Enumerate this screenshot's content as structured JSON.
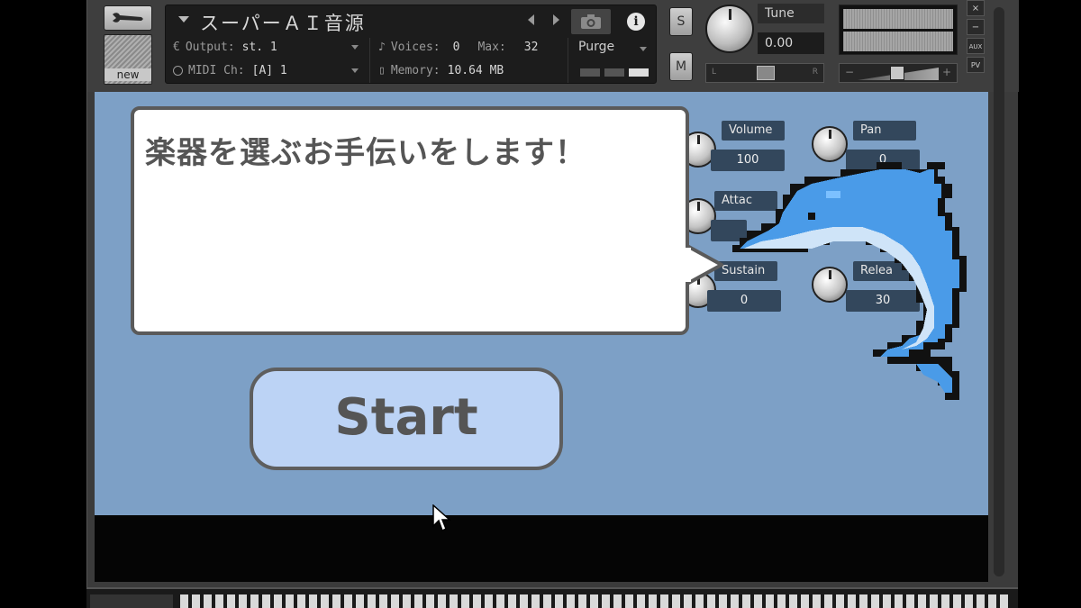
{
  "header": {
    "instrument_name": "スーパーＡＩ音源",
    "output_label": "Output:",
    "output_value": "st. 1",
    "midi_label": "MIDI Ch:",
    "midi_value": "[A]  1",
    "voices_label": "Voices:",
    "voices_value": "0",
    "max_label": "Max:",
    "max_value": "32",
    "memory_label": "Memory:",
    "memory_value": "10.64 MB",
    "purge_label": "Purge",
    "new_label": "new",
    "solo_label": "S",
    "mute_label": "M",
    "tune_label": "Tune",
    "tune_value": "0.00",
    "pan_left": "L",
    "pan_right": "R",
    "vol_minus": "−",
    "vol_plus": "+",
    "close_label": "×",
    "minimize_label": "−",
    "aux_label": "AUX",
    "pv_label": "PV",
    "info_label": "i"
  },
  "controls": {
    "volume_label": "Volume",
    "volume_value": "100",
    "pan_label": "Pan",
    "pan_value": "0",
    "attack_label": "Attac",
    "sustain_label": "Sustain",
    "sustain_value": "0",
    "release_label": "Relea",
    "release_value": "30"
  },
  "bubble": {
    "text": "楽器を選ぶお手伝いをします！"
  },
  "start_button": {
    "label": "Start"
  },
  "colors": {
    "ui_background": "#7da0c6",
    "start_button": "#bcd3f5",
    "dolphin": "#4a9be8",
    "label_bg": "#33475c"
  },
  "icons": [
    "wrench-icon",
    "camera-icon",
    "info-icon",
    "dolphin-mascot",
    "mouse-cursor-icon"
  ]
}
